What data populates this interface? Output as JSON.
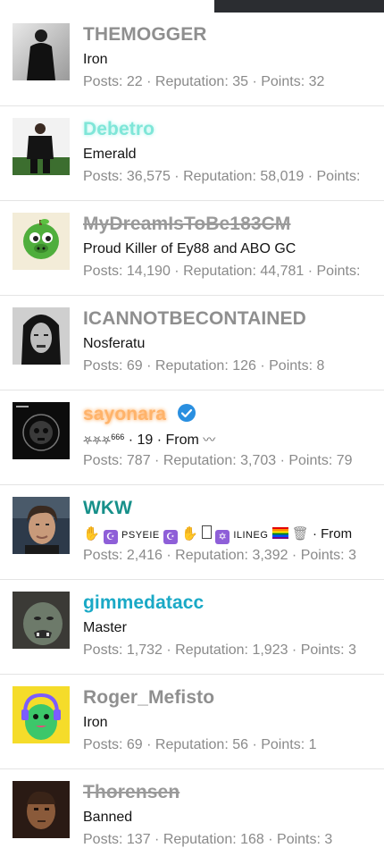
{
  "members": [
    {
      "name": "THEMOGGER",
      "subtitle": "Iron",
      "stats": "Posts: 22 · Reputation: 35 · Points: 32",
      "name_color": "#8f8f8f"
    },
    {
      "name": "Debetro",
      "subtitle": "Emerald",
      "stats": "Posts: 36,575 · Reputation: 58,019 · Points:",
      "name_color": "#7fe6d8"
    },
    {
      "name": "MyDreamIsToBe183CM",
      "subtitle": "Proud Killer of Ey88 and ABO GC",
      "stats": "Posts: 14,190 · Reputation: 44,781 · Points:",
      "name_color": "#9a9a9a"
    },
    {
      "name": "ICANNOTBECONTAINED",
      "subtitle": "Nosferatu",
      "stats": "Posts: 69 · Reputation: 126 · Points: 8",
      "name_color": "#8f8f8f"
    },
    {
      "name": "sayonara",
      "subtitle_prefix": "⛧⛧⛧",
      "subtitle_666": "666",
      "subtitle_rest": "· 19 · From",
      "stats": "Posts: 787 · Reputation: 3,703 · Points: 79",
      "name_color": "#ffb36a"
    },
    {
      "name": "WKW",
      "subtitle_psyeie": "PSYEIE",
      "subtitle_ilineg": "ILINEG",
      "subtitle_from": "· From",
      "stats": "Posts: 2,416 · Reputation: 3,392 · Points: 3",
      "name_color": "#17908a"
    },
    {
      "name": "gimmedatacc",
      "subtitle": "Master",
      "stats": "Posts: 1,732 · Reputation: 1,923 · Points: 3",
      "name_color": "#1aa9c6"
    },
    {
      "name": "Roger_Mefisto",
      "subtitle": "Iron",
      "stats": "Posts: 69 · Reputation: 56 · Points: 1",
      "name_color": "#8f8f8f"
    },
    {
      "name": "Thorensen",
      "subtitle": "Banned",
      "stats": "Posts: 137 · Reputation: 168 · Points: 3",
      "name_color": "#9a9a9a"
    }
  ],
  "icons": {
    "verified": "verified-badge-icon",
    "flag": "rainbow-flag-icon",
    "trash": "trash-icon"
  }
}
